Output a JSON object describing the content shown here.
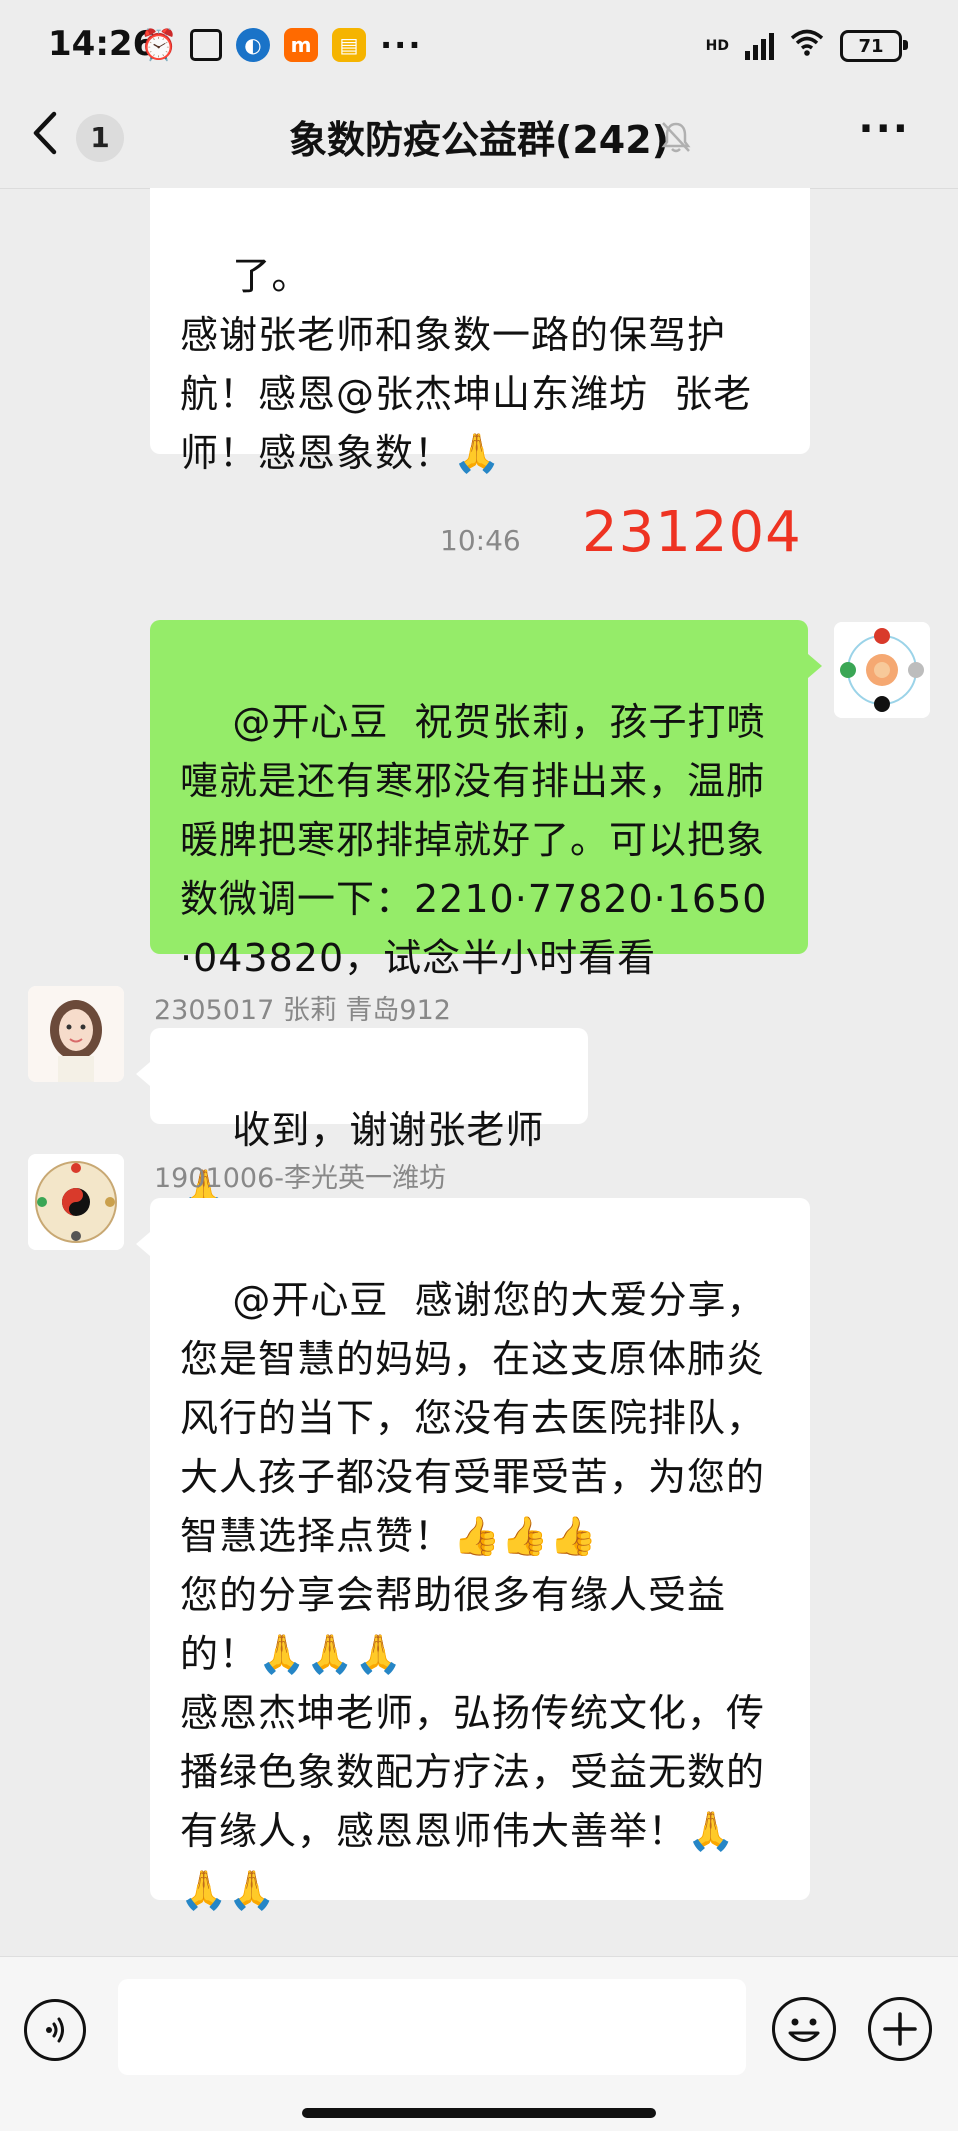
{
  "status_bar": {
    "time": "14:26",
    "network": "HD",
    "battery": "71",
    "more": "···"
  },
  "header": {
    "back_count": "1",
    "title": "象数防疫公益群(242)",
    "more": "···"
  },
  "messages": [
    {
      "side": "left",
      "continued": true,
      "text": "了。\n感谢张老师和象数一路的保驾护航！感恩@张杰坤山东潍坊  张老师！感恩象数！🙏"
    },
    {
      "side": "right",
      "text": "@开心豆  祝贺张莉，孩子打喷嚏就是还有寒邪没有排出来，温肺暖脾把寒邪排掉就好了。可以把象数微调一下：2210·77820·1650·043820，试念半小时看看"
    },
    {
      "side": "left",
      "sender": "2305017 张莉 青岛912",
      "text": "收到，谢谢张老师🙏"
    },
    {
      "side": "left",
      "sender": "1901006-李光英一潍坊",
      "text": "@开心豆  感谢您的大爱分享，您是智慧的妈妈，在这支原体肺炎风行的当下，您没有去医院排队，大人孩子都没有受罪受苦，为您的智慧选择点赞！👍👍👍\n您的分享会帮助很多有缘人受益的！🙏🙏🙏\n感恩杰坤老师，弘扬传统文化，传播绿色象数配方疗法，受益无数的有缘人，感恩恩师伟大善举！🙏🙏🙏"
    }
  ],
  "timestamp": "10:46",
  "annotation": "231204",
  "input": {
    "value": "",
    "placeholder": ""
  },
  "colors": {
    "background": "#ededed",
    "bubble_self": "#95ec69",
    "bubble_other": "#ffffff",
    "annotation": "#ee3322"
  }
}
